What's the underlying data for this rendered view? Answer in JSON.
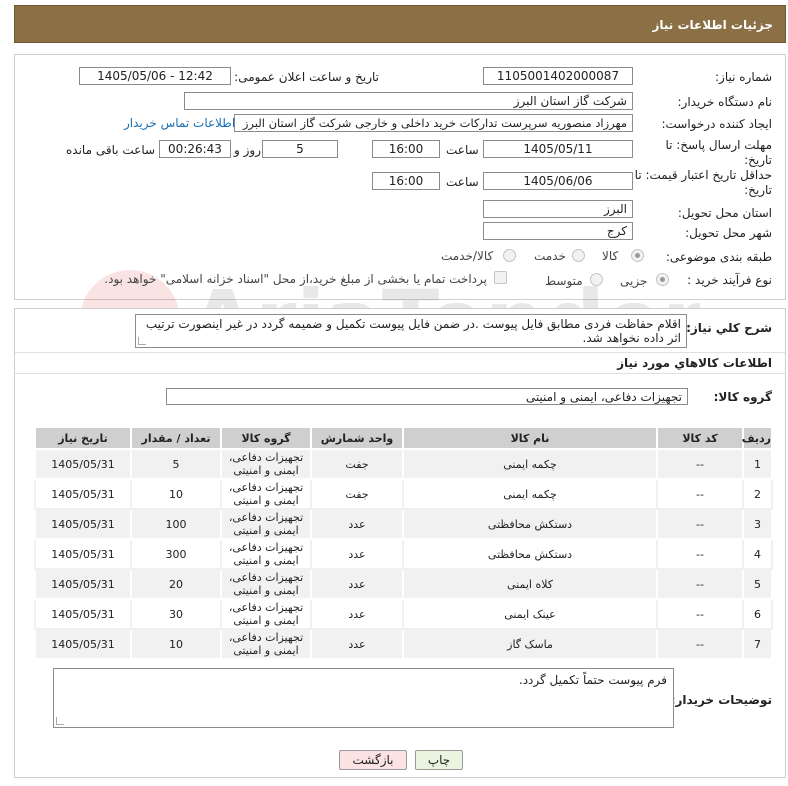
{
  "header": {
    "title": "جزئیات اطلاعات نیاز"
  },
  "form": {
    "need_number_label": "شماره نیاز:",
    "need_number": "1105001402000087",
    "announce_label": "تاریخ و ساعت اعلان عمومی:",
    "announce_value": "1405/05/06 - 12:42",
    "buyer_org_label": "نام دستگاه خریدار:",
    "buyer_org": "شرکت گاز استان البرز",
    "creator_label": "ایجاد کننده درخواست:",
    "creator": "مهرزاد منصوریه سرپرست تدارکات خرید داخلی و خارجی شرکت گاز استان البرز",
    "contact_link": "اطلاعات تماس خریدار",
    "deadline_label": "مهلت ارسال پاسخ: تا تاریخ:",
    "deadline_date": "1405/05/11",
    "time_label": "ساعت",
    "deadline_time": "16:00",
    "days_value": "5",
    "days_label": "روز و",
    "remaining_time": "00:26:43",
    "remaining_label": "ساعت باقی مانده",
    "validity_label": "حداقل تاریخ اعتبار قیمت: تا تاریخ:",
    "validity_date": "1405/06/06",
    "validity_time": "16:00",
    "province_label": "استان محل تحویل:",
    "province": "البرز",
    "city_label": "شهر محل تحویل:",
    "city": "کرج",
    "category_label": "طبقه بندی موضوعی:",
    "category_options": [
      "کالا",
      "خدمت",
      "کالا/خدمت"
    ],
    "purchase_type_label": "نوع فرآیند خرید :",
    "purchase_options": [
      "جزیی",
      "متوسط"
    ],
    "payment_note": "پرداخت تمام یا بخشی از مبلغ خرید،از محل \"اسناد خزانه اسلامی\" خواهد بود."
  },
  "details": {
    "description_label": "شرح كلي نياز:",
    "description": "اقلام حفاظت فردی مطابق فایل پیوست .در ضمن فایل پیوست تکمیل و ضمیمه گردد در غیر اینصورت ترتیب اثر داده نخواهد شد.",
    "goods_info_label": "اطلاعات کالاهاي مورد نياز",
    "goods_group_label": "گروه کالا:",
    "goods_group": "تجهیزات دفاعی، ایمنی و امنیتی"
  },
  "table": {
    "headers": [
      "رديف",
      "کد کالا",
      "نام کالا",
      "واحد شمارش",
      "گروه کالا",
      "تعداد / مقدار",
      "تاریخ نیاز"
    ],
    "rows": [
      [
        "1",
        "--",
        "چکمه ایمنی",
        "جفت",
        "تجهیزات دفاعی، ایمنی و امنیتی",
        "5",
        "1405/05/31"
      ],
      [
        "2",
        "--",
        "چکمه ایمنی",
        "جفت",
        "تجهیزات دفاعی، ایمنی و امنیتی",
        "10",
        "1405/05/31"
      ],
      [
        "3",
        "--",
        "دستکش محافظتی",
        "عدد",
        "تجهیزات دفاعی، ایمنی و امنیتی",
        "100",
        "1405/05/31"
      ],
      [
        "4",
        "--",
        "دستکش محافظتی",
        "عدد",
        "تجهیزات دفاعی، ایمنی و امنیتی",
        "300",
        "1405/05/31"
      ],
      [
        "5",
        "--",
        "کلاه ایمنی",
        "عدد",
        "تجهیزات دفاعی، ایمنی و امنیتی",
        "20",
        "1405/05/31"
      ],
      [
        "6",
        "--",
        "عینک ایمنی",
        "عدد",
        "تجهیزات دفاعی، ایمنی و امنیتی",
        "30",
        "1405/05/31"
      ],
      [
        "7",
        "--",
        "ماسک گاز",
        "عدد",
        "تجهیزات دفاعی، ایمنی و امنیتی",
        "10",
        "1405/05/31"
      ]
    ]
  },
  "buyer_notes": {
    "label": "توضیحات خریدار:",
    "text": "فرم پیوست حتماً تکمیل گردد."
  },
  "buttons": {
    "print": "چاپ",
    "back": "بازگشت"
  },
  "watermark": {
    "text": "AriaTender.neT"
  },
  "colors": {
    "header_bg": "#8b7046",
    "link": "#1a6fb5",
    "back_button_bg": "#fbe3e3",
    "print_button_bg": "#e9f5e0"
  }
}
